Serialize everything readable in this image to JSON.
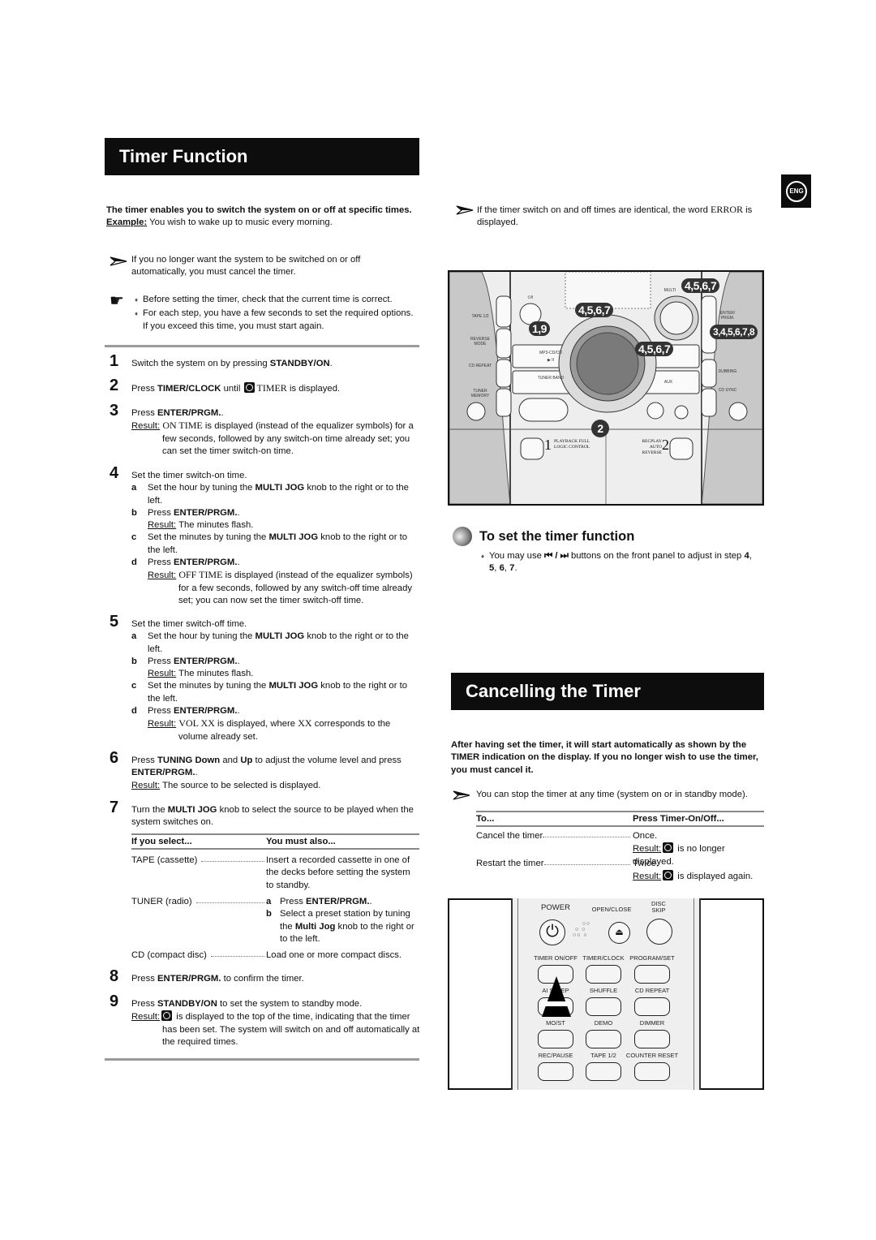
{
  "timer_function": {
    "title": "Timer Function",
    "intro_bold": "The timer enables you to switch the system on or off at specific times.",
    "example_label": "Example:",
    "example_text": " You wish to wake up to music every morning.",
    "note_cancel": "If you no longer want the system to be switched on or off automatically, you must cancel the timer.",
    "tips": [
      "Before setting the timer, check that the current time is correct.",
      "For each step, you have a few seconds to set the required options. If you exceed this time, you must start again."
    ],
    "steps": {
      "s1": {
        "n": "1",
        "a": "Switch the system on by pressing ",
        "b": "STANDBY/ON",
        "c": "."
      },
      "s2": {
        "n": "2",
        "a": "Press ",
        "b": "TIMER/CLOCK",
        "c": " until ",
        "d": "TIMER",
        "e": " is displayed."
      },
      "s3": {
        "n": "3",
        "a": "Press ",
        "b": "ENTER/PRGM.",
        "c": ".",
        "result_label": "Result:",
        "r1": "ON TIME",
        "r2": " is displayed (instead of the equalizer symbols) for a few seconds, followed by any switch-on time already set; you can set the timer switch-on time."
      },
      "s4": {
        "n": "4",
        "text": "Set the timer switch-on time.",
        "a": {
          "l": "a",
          "t1": "Set the hour by tuning the ",
          "t2": "MULTI JOG",
          "t3": " knob to the right or to the left."
        },
        "b": {
          "l": "b",
          "t1": "Press ",
          "t2": "ENTER/PRGM.",
          "t3": ".",
          "result_label": "Result:",
          "result": " The minutes flash."
        },
        "c": {
          "l": "c",
          "t1": "Set the minutes by tuning the ",
          "t2": "MULTI JOG",
          "t3": " knob to the right or to the left."
        },
        "d": {
          "l": "d",
          "t1": "Press ",
          "t2": "ENTER/PRGM.",
          "t3": ".",
          "result_label": "Result:",
          "r1": "OFF TIME",
          "r2": " is displayed (instead of the equalizer symbols) for a few seconds, followed by any switch-off time already set; you can now set the timer switch-off time."
        }
      },
      "s5": {
        "n": "5",
        "text": "Set the timer switch-off time.",
        "a": {
          "l": "a",
          "t1": "Set the hour by tuning the ",
          "t2": "MULTI JOG",
          "t3": " knob to the right or to the left."
        },
        "b": {
          "l": "b",
          "t1": "Press ",
          "t2": "ENTER/PRGM.",
          "t3": ".",
          "result_label": "Result:",
          "result": " The minutes flash."
        },
        "c": {
          "l": "c",
          "t1": "Set the minutes by tuning the ",
          "t2": "MULTI JOG",
          "t3": " knob to the right or to the left."
        },
        "d": {
          "l": "d",
          "t1": "Press ",
          "t2": "ENTER/PRGM.",
          "t3": ".",
          "result_label": "Result:",
          "r1": "VOL XX",
          "r2": " is displayed, where ",
          "r3": "XX",
          "r4": " corresponds to the volume already set."
        }
      },
      "s6": {
        "n": "6",
        "a": "Press ",
        "b": "TUNING Down",
        "c": " and ",
        "d": "Up",
        "e": " to adjust the volume level and press ",
        "f": "ENTER/PRGM.",
        "g": ".",
        "result_label": "Result:",
        "result": " The source to be selected is displayed."
      },
      "s7": {
        "n": "7",
        "a": "Turn the ",
        "b": "MULTI JOG",
        "c": " knob to select the source to be played when the system switches on."
      },
      "s8": {
        "n": "8",
        "a": "Press ",
        "b": "ENTER/PRGM.",
        "c": " to confirm the timer."
      },
      "s9": {
        "n": "9",
        "a": "Press ",
        "b": "STANDBY/ON",
        "c": " to set the system to standby mode.",
        "result_label": "Result:",
        "result": " is displayed to the top of the time, indicating that the timer has been set. The system will switch on and off automatically at the required times."
      }
    },
    "source_table": {
      "headers": [
        "If you select...",
        "You must also..."
      ],
      "rows": [
        {
          "select": "TAPE (cassette)",
          "action": "Insert a recorded cassette in one of the decks before setting the system to standby."
        },
        {
          "select": "TUNER (radio)",
          "a_l": "a",
          "a1": "Press ",
          "a2": "ENTER/PRGM.",
          "a3": ".",
          "b_l": "b",
          "b1": "Select a preset station by tuning the ",
          "b2": "Multi Jog",
          "b3": " knob to the right or to the left."
        },
        {
          "select": "CD (compact disc)",
          "action": "Load one or more compact discs."
        }
      ]
    }
  },
  "lang_badge": "ENG",
  "error_note": {
    "a": "If the timer switch on and off times are identical, the word ",
    "b": "ERROR",
    "c": " is displayed."
  },
  "device_diagram": {
    "callouts": [
      "4,5,6,7",
      "4,5,6,7",
      "4,5,6,7",
      "1,9",
      "3,4,5,6,7,8",
      "2"
    ],
    "labels": {
      "tape": "TAPE 1/2",
      "reverse": "REVERSE MODE",
      "cdrepeat": "CD REPEAT",
      "tunermem": "TUNER MEMORY",
      "mp3": "MP3-CD/CD",
      "play": "▶ II",
      "tunerband": "TUNER BAND",
      "aux": "AUX",
      "enter": "ENTER/ PRGM.",
      "dubbing": "DUBBING",
      "cdsync": "CD SYNC",
      "multi": "MULTI",
      "standby": "⏻/I",
      "deck1": "1",
      "deck1_text": "PLAYBACK FULL LOGIC CONTROL",
      "deck2": "2",
      "deck2_text": "RECPLAY AUTO REVERSE"
    }
  },
  "set_timer": {
    "heading": "To set the timer function",
    "a": "You may use ",
    "icons": "⏮ / ⏭",
    "b": " buttons on the front panel to adjust in step ",
    "s": [
      "4",
      "5",
      "6",
      "7"
    ]
  },
  "cancelling": {
    "title": "Cancelling the Timer",
    "intro_bold": "After having set the timer, it will start automatically as shown by the TIMER indication on the display. If you no longer wish to use the timer, you must cancel it.",
    "note": "You can stop the timer at any time (system on or in standby mode).",
    "table": {
      "headers": [
        "To...",
        "Press Timer-On/Off..."
      ],
      "rows": [
        {
          "to": "Cancel the timer",
          "press": "Once.",
          "result_label": "Result:",
          "result": " is no longer displayed."
        },
        {
          "to": "Restart the timer",
          "press": "Twice.",
          "result_label": "Result:",
          "result": " is displayed again."
        }
      ]
    }
  },
  "remote": {
    "power": "POWER",
    "open_close": "OPEN/CLOSE",
    "disc_skip": "DISC SKIP",
    "buttons": [
      "TIMER ON/OFF",
      "TIMER/CLOCK",
      "PROGRAM/SET",
      "AI SLEEP",
      "SHUFFLE",
      "CD REPEAT",
      "MO/ST",
      "DEMO",
      "DIMMER",
      "REC/PAUSE",
      "TAPE 1/2",
      "COUNTER RESET"
    ]
  }
}
